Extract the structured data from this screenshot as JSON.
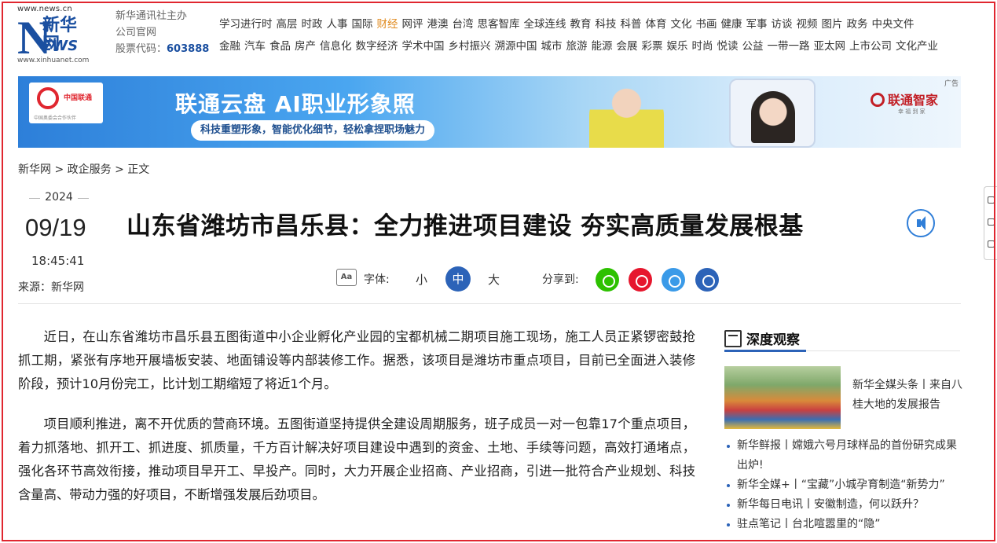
{
  "header": {
    "logo": {
      "url_top": "www.news.cn",
      "n": "N",
      "name": "新华网",
      "ews": "EWS",
      "url_bottom": "www.xinhuanet.com"
    },
    "org_line1": "新华通讯社主办",
    "org_line2": "公司官网",
    "stock_label": "股票代码：",
    "stock_code": "603888",
    "nav_row1": [
      "学习进行时",
      "高层",
      "时政",
      "人事",
      "国际",
      "财经",
      "网评",
      "港澳",
      "台湾",
      "思客智库",
      "全球连线",
      "教育",
      "科技",
      "科普",
      "体育",
      "文化",
      "书画",
      "健康",
      "军事",
      "访谈",
      "视频",
      "图片",
      "政务",
      "中央文件"
    ],
    "nav_row2": [
      "金融",
      "汽车",
      "食品",
      "房产",
      "信息化",
      "数字经济",
      "学术中国",
      "乡村振兴",
      "溯源中国",
      "城市",
      "旅游",
      "能源",
      "会展",
      "彩票",
      "娱乐",
      "时尚",
      "悦读",
      "公益",
      "一带一路",
      "亚太网",
      "上市公司",
      "文化产业"
    ],
    "nav_highlight": "财经"
  },
  "banner": {
    "title": "联通云盘 AI职业形象照",
    "subtitle": "科技重塑形象，智能优化细节，轻松拿捏职场魅力",
    "logo_text": "中国联通",
    "logo_sub": "中国奥委会合作伙伴",
    "brand": "联通智家",
    "brand_sub": "幸 福 到 家",
    "ad_tag": "广告"
  },
  "breadcrumb": "新华网 > 政企服务 > 正文",
  "meta": {
    "year": "2024",
    "date": "09/19",
    "time": "18:45:41",
    "source": "来源：新华网"
  },
  "headline": "山东省潍坊市昌乐县：全力推进项目建设 夯实高质量发展根基",
  "toolbar": {
    "aa_icon": "Aa",
    "font_label": "字体:",
    "font_small": "小",
    "font_medium": "中",
    "font_large": "大",
    "share_label": "分享到:"
  },
  "share_colors": {
    "wechat": "#2dc100",
    "weibo": "#e6162d",
    "link": "#3a9ae8",
    "mobile": "#2c63b8"
  },
  "article": {
    "paragraphs": [
      "近日，在山东省潍坊市昌乐县五图街道中小企业孵化产业园的宝都机械二期项目施工现场，施工人员正紧锣密鼓抢抓工期，紧张有序地开展墙板安装、地面铺设等内部装修工作。据悉，该项目是潍坊市重点项目，目前已全面进入装修阶段，预计10月份完工，比计划工期缩短了将近1个月。",
      "项目顺利推进，离不开优质的营商环境。五图街道坚持提供全建设周期服务，班子成员一对一包靠17个重点项目，着力抓落地、抓开工、抓进度、抓质量，千方百计解决好项目建设中遇到的资金、土地、手续等问题，高效打通堵点，强化各环节高效衔接，推动项目早开工、早投产。同时，大力开展企业招商、产业招商，引进一批符合产业规划、科技含量高、带动力强的好项目，不断增强发展后劲项目。"
    ]
  },
  "sidebar": {
    "title": "深度观察",
    "featured_caption": "新华全媒头条丨来自八桂大地的发展报告",
    "items": [
      "新华鲜报丨嫦娥六号月球样品的首份研究成果出炉!",
      "新华全媒+丨“宝藏”小城孕育制造“新势力”",
      "新华每日电讯丨安徽制造，何以跃升？",
      "驻点笔记丨台北喧嚣里的“隐”"
    ]
  }
}
